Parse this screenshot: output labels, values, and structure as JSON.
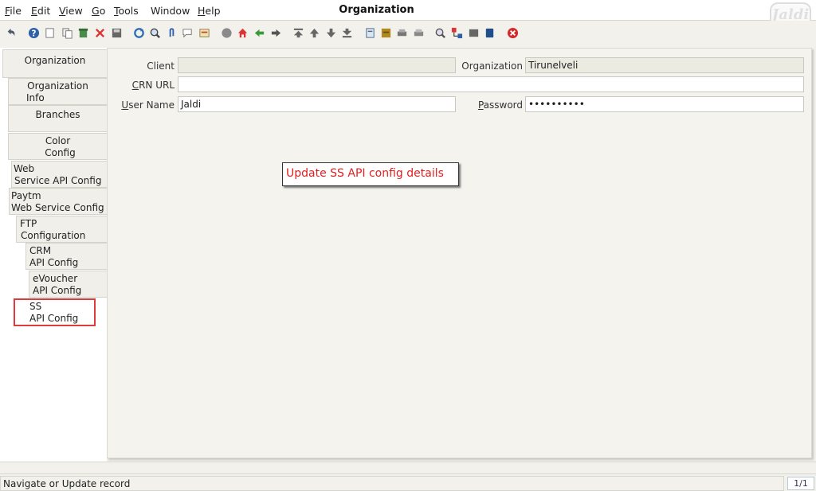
{
  "window": {
    "title": "Organization"
  },
  "menu": [
    {
      "label": "File",
      "mnemonic": "F",
      "rest": "ile"
    },
    {
      "label": "Edit",
      "mnemonic": "E",
      "rest": "dit"
    },
    {
      "label": "View",
      "mnemonic": "V",
      "rest": "iew"
    },
    {
      "label": "Go",
      "mnemonic": "G",
      "rest": "o"
    },
    {
      "label": "Tools",
      "mnemonic": "T",
      "rest": "ools"
    },
    {
      "label": "Window",
      "mnemonic": "",
      "rest": "Window"
    },
    {
      "label": "Help",
      "mnemonic": "H",
      "rest": "elp"
    }
  ],
  "logo": {
    "text": "Jaldi"
  },
  "toolbar": {
    "icons": [
      "undo-icon",
      "help-icon",
      "new-record-icon",
      "copy-record-icon",
      "delete-icon",
      "delete-selection-icon",
      "save-icon",
      "refresh-icon",
      "find-icon",
      "attachment-icon",
      "chat-icon",
      "history-icon",
      "home-icon",
      "parent-record-icon",
      "back-icon",
      "forward-icon",
      "first-record-icon",
      "previous-record-icon",
      "next-record-icon",
      "last-record-icon",
      "report-icon",
      "archive-icon",
      "print-preview-icon",
      "print-icon",
      "zoom-across-icon",
      "workflow-icon",
      "product-info-icon",
      "process-icon",
      "exit-icon"
    ]
  },
  "tabs": [
    {
      "label": "Organization",
      "lines": [
        "Organization"
      ]
    },
    {
      "label": "Organization Info",
      "lines": [
        "Organization",
        "Info"
      ]
    },
    {
      "label": "Branches",
      "lines": [
        "Branches"
      ]
    },
    {
      "label": "Color Config",
      "lines": [
        "Color",
        "Config"
      ]
    },
    {
      "label": "Web Service API Config",
      "lines": [
        "Web",
        "Service API Config"
      ]
    },
    {
      "label": "Paytm Web Service Config",
      "lines": [
        "Paytm",
        "Web Service Config"
      ]
    },
    {
      "label": "FTP Configuration",
      "lines": [
        "FTP",
        "Configuration"
      ]
    },
    {
      "label": "CRM API Config",
      "lines": [
        "CRM",
        "API Config"
      ]
    },
    {
      "label": "eVoucher API Config",
      "lines": [
        "eVoucher",
        "API Config"
      ]
    },
    {
      "label": "SS API Config",
      "lines": [
        "SS",
        "API Config"
      ],
      "selected": true
    }
  ],
  "form": {
    "client": {
      "label": "Client",
      "value": ""
    },
    "organization": {
      "label": "Organization",
      "value": "Tirunelveli"
    },
    "crn_url": {
      "label": "CRN URL",
      "mnemonic": "C",
      "rest": "RN URL",
      "value": ""
    },
    "user_name": {
      "label": "User Name",
      "mnemonic": "U",
      "rest": "ser Name",
      "value": "Jaldi"
    },
    "password": {
      "label": "Password",
      "mnemonic": "P",
      "rest": "assword",
      "value": "••••••••••"
    }
  },
  "annotation": {
    "text": "Update SS API config details"
  },
  "status": {
    "text": "Navigate or Update record",
    "record": "1/1"
  }
}
